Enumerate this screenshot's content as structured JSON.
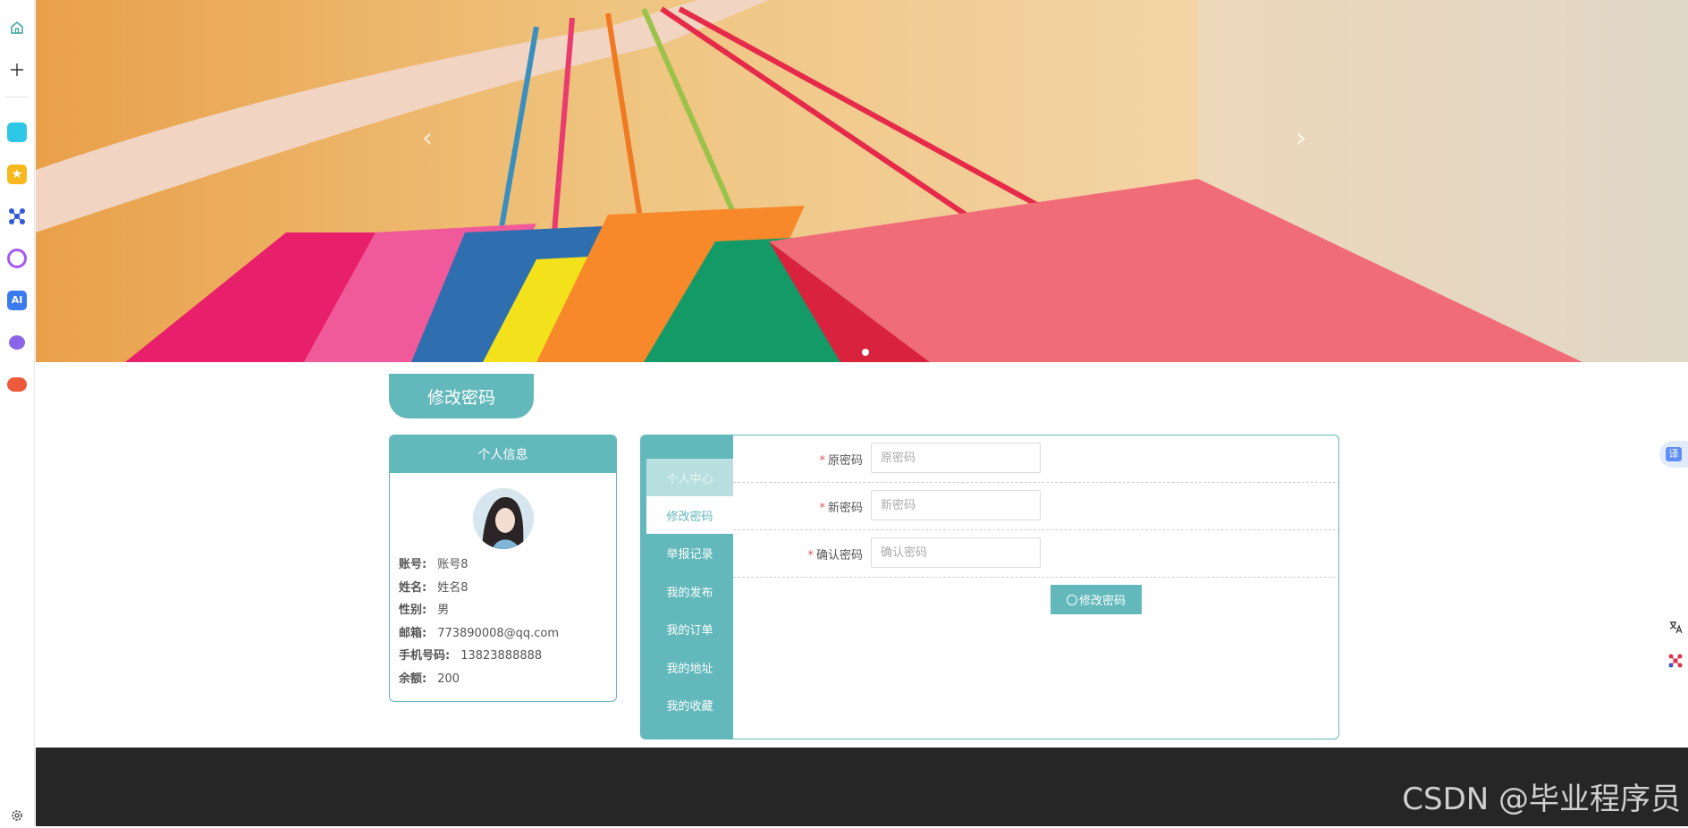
{
  "sidebar": {
    "icons": [
      "home-icon",
      "plus-icon",
      "app-1-icon",
      "star-app-icon",
      "network-app-icon",
      "ai-ring-app-icon",
      "ai-app-icon",
      "bot-app-icon",
      "game-app-icon",
      "settings-icon"
    ]
  },
  "banner": {
    "prev_arrow": "‹",
    "next_arrow": "›",
    "slide_count": 1,
    "active_slide": 1
  },
  "page_title": "修改密码",
  "profile": {
    "header": "个人信息",
    "fields": [
      {
        "label": "账号:",
        "value": "账号8"
      },
      {
        "label": "姓名:",
        "value": "姓名8"
      },
      {
        "label": "性别:",
        "value": "男"
      },
      {
        "label": "邮箱:",
        "value": "773890008@qq.com"
      },
      {
        "label": "手机号码:",
        "value": "13823888888"
      },
      {
        "label": "余额:",
        "value": "200"
      }
    ]
  },
  "tabs": [
    {
      "label": "个人中心",
      "state": "faded"
    },
    {
      "label": "修改密码",
      "state": "active"
    },
    {
      "label": "举报记录",
      "state": "normal"
    },
    {
      "label": "我的发布",
      "state": "normal"
    },
    {
      "label": "我的订单",
      "state": "normal"
    },
    {
      "label": "我的地址",
      "state": "normal"
    },
    {
      "label": "我的收藏",
      "state": "normal"
    }
  ],
  "form": {
    "required_mark": "*",
    "fields": [
      {
        "label": "原密码",
        "placeholder": "原密码",
        "value": ""
      },
      {
        "label": "新密码",
        "placeholder": "新密码",
        "value": ""
      },
      {
        "label": "确认密码",
        "placeholder": "确认密码",
        "value": ""
      }
    ],
    "submit_label": "修改密码"
  },
  "footer": {
    "watermark": "CSDN @毕业程序员"
  },
  "floating": {
    "translate_label": "译"
  },
  "colors": {
    "accent": "#63b8bb",
    "footer_bg": "#262626",
    "required": "#e05555"
  }
}
